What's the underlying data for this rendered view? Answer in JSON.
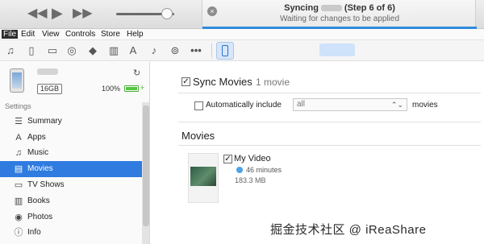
{
  "player": {
    "prev_icon": "rewind-icon",
    "play_icon": "play-icon",
    "next_icon": "fast-forward-icon",
    "volume_level": 0.88
  },
  "status": {
    "title_prefix": "Syncing",
    "title_suffix": "(Step 6 of 6)",
    "subtitle": "Waiting for changes to be applied",
    "progress": 1.0
  },
  "menu": [
    "File",
    "Edit",
    "View",
    "Controls",
    "Store",
    "Help"
  ],
  "toolbar": {
    "icons": [
      "music-icon",
      "film-icon",
      "tv-icon",
      "podcast-icon",
      "graduation-cap-icon",
      "book-icon",
      "app-store-icon",
      "bell-icon",
      "radio-icon",
      "more-icon"
    ],
    "more_label": "•••",
    "device_icon": "iphone-icon"
  },
  "device": {
    "capacity": "16GB",
    "battery": "100%",
    "battery_level": 1.0,
    "plus": "+"
  },
  "sidebar": {
    "section": "Settings",
    "items": [
      {
        "label": "Summary",
        "icon": "list-icon",
        "glyph": "☰"
      },
      {
        "label": "Apps",
        "icon": "apps-icon",
        "glyph": "A"
      },
      {
        "label": "Music",
        "icon": "music-note-icon",
        "glyph": "♫"
      },
      {
        "label": "Movies",
        "icon": "film-icon",
        "glyph": "▤"
      },
      {
        "label": "TV Shows",
        "icon": "tv-icon",
        "glyph": "▭"
      },
      {
        "label": "Books",
        "icon": "book-icon",
        "glyph": "▥"
      },
      {
        "label": "Photos",
        "icon": "camera-icon",
        "glyph": "◉"
      },
      {
        "label": "Info",
        "icon": "info-icon",
        "glyph": "ⓘ"
      }
    ],
    "active_index": 3
  },
  "main": {
    "sync_label": "Sync Movies",
    "sync_count": "1 movie",
    "sync_checked": true,
    "auto_label": "Automatically include",
    "auto_checked": false,
    "auto_value": "all",
    "auto_suffix": "movies",
    "section_title": "Movies",
    "movie": {
      "title": "My Video",
      "checked": true,
      "duration": "46 minutes",
      "size": "183.3 MB"
    }
  },
  "watermark": "掘金技术社区 @ iReaShare"
}
